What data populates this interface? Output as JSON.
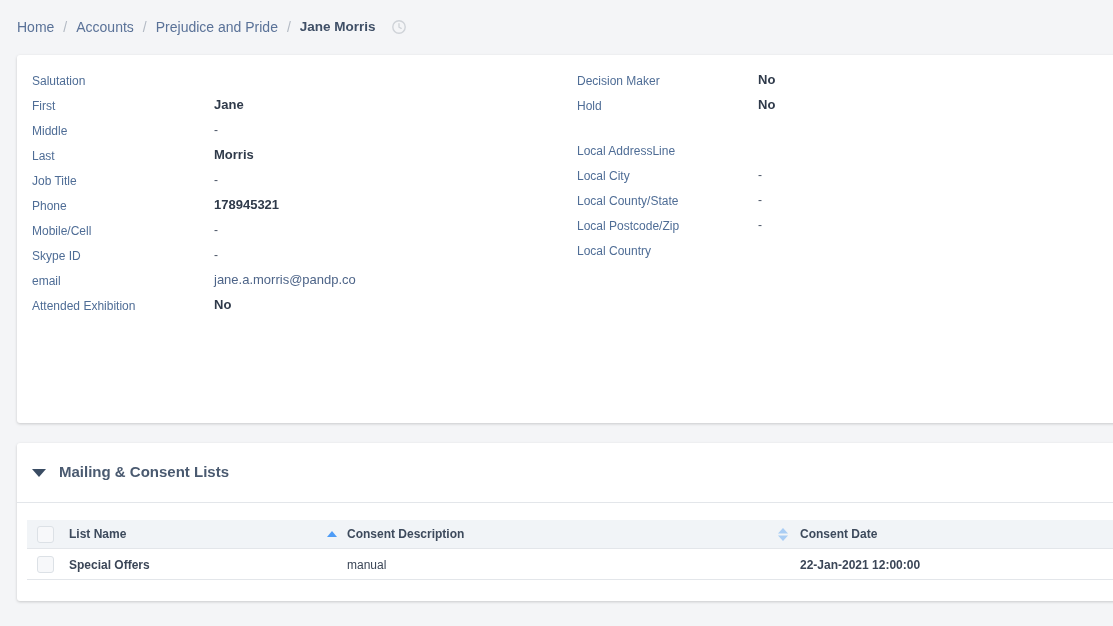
{
  "breadcrumb": {
    "items": [
      {
        "label": "Home",
        "current": false
      },
      {
        "separator": "/",
        "label": "Accounts",
        "current": false
      },
      {
        "separator": "/",
        "label": "Prejudice and Pride",
        "current": false
      },
      {
        "separator": "/",
        "label": "Jane Morris",
        "current": true
      }
    ]
  },
  "details": {
    "left_fields": [
      {
        "label": "Salutation"
      },
      {
        "label": "First",
        "value": "Jane",
        "kind": "text"
      },
      {
        "label": "Middle",
        "value": "-",
        "kind": "blank"
      },
      {
        "label": "Last",
        "value": "Morris",
        "kind": "text"
      },
      {
        "label": "Job Title",
        "value": "-",
        "kind": "blank"
      },
      {
        "label": "Phone",
        "value": "178945321",
        "kind": "text"
      },
      {
        "label": "Mobile/Cell",
        "value": "-",
        "kind": "blank"
      },
      {
        "label": "Skype ID",
        "value": "-",
        "kind": "blank"
      },
      {
        "label": "email",
        "value": "jane.a.morris@pandp.co",
        "kind": "email"
      },
      {
        "label": "Attended Exhibition",
        "value": "No",
        "kind": "text"
      }
    ],
    "right_groups": [
      {
        "fields": [
          {
            "label": "Decision Maker",
            "value": "No",
            "kind": "text"
          },
          {
            "label": "Hold",
            "value": "No",
            "kind": "text"
          }
        ]
      },
      {
        "fields": [
          {
            "label": "Local AddressLine"
          },
          {
            "label": "Local City",
            "value": "-",
            "kind": "blank"
          },
          {
            "label": "Local County/State",
            "value": "-",
            "kind": "blank"
          },
          {
            "label": "Local Postcode/Zip",
            "value": "-",
            "kind": "blank"
          },
          {
            "label": "Local Country"
          }
        ]
      }
    ]
  },
  "mailing_section": {
    "title": "Mailing & Consent Lists",
    "expanded": true,
    "table": {
      "header_checked": false,
      "columns": [
        {
          "label": "List Name",
          "sorted": true
        },
        {
          "label": "Consent Description",
          "sorted": false
        },
        {
          "label": "Consent Date"
        }
      ],
      "rows": [
        {
          "checked": false,
          "cells": [
            "Special Offers",
            "manual",
            "22-Jan-2021 12:00:00"
          ]
        }
      ]
    }
  }
}
